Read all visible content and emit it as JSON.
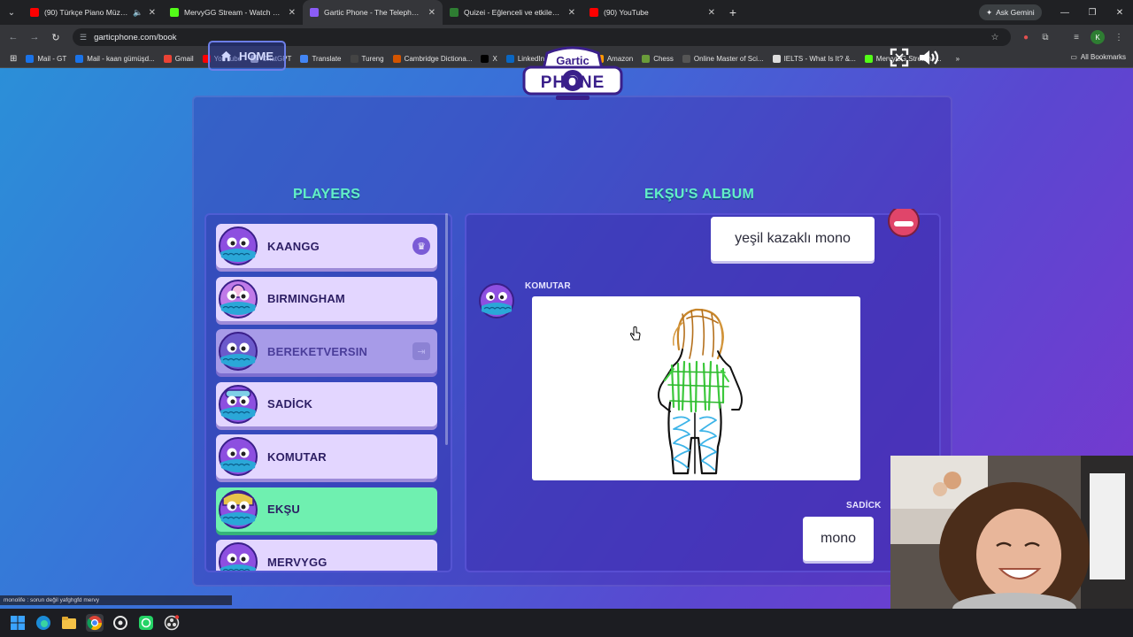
{
  "browser": {
    "tabs": [
      {
        "title": "(90) Türkçe Piano Müzikleri",
        "favicon_color": "#ff0000",
        "audio": true
      },
      {
        "title": "MervyGG Stream - Watch Live",
        "favicon_color": "#53fc18"
      },
      {
        "title": "Gartic Phone - The Telephone G",
        "favicon_color": "#8b5cf6",
        "active": true
      },
      {
        "title": "Quizei - Eğlenceli ve etkileşimli",
        "favicon_color": "#2e7d32"
      },
      {
        "title": "(90) YouTube",
        "favicon_color": "#ff0000"
      }
    ],
    "gemini_label": "Ask Gemini",
    "url": "garticphone.com/book",
    "bookmarks": [
      {
        "label": "Mail - GT",
        "color": "#1a73e8"
      },
      {
        "label": "Mail - kaan gümüşd...",
        "color": "#1a73e8"
      },
      {
        "label": "Gmail",
        "color": "#ea4335"
      },
      {
        "label": "YouTube",
        "color": "#ff0000"
      },
      {
        "label": "ChatGPT",
        "color": "#cccccc"
      },
      {
        "label": "Translate",
        "color": "#4285f4"
      },
      {
        "label": "Tureng",
        "color": "#444444"
      },
      {
        "label": "Cambridge Dictiona...",
        "color": "#d35400"
      },
      {
        "label": "X",
        "color": "#000000"
      },
      {
        "label": "LinkedIn",
        "color": "#0a66c2"
      },
      {
        "label": "Writing",
        "color": "#333333"
      },
      {
        "label": "Amazon",
        "color": "#ff9900"
      },
      {
        "label": "Chess",
        "color": "#6a9c3a"
      },
      {
        "label": "Online Master of Sci...",
        "color": "#555555"
      },
      {
        "label": "IELTS - What Is It? &...",
        "color": "#dddddd"
      },
      {
        "label": "MervyGG Stream -...",
        "color": "#53fc18"
      }
    ],
    "all_bookmarks": "All Bookmarks"
  },
  "game": {
    "home_label": "HOME",
    "logo_top": "Gartic",
    "logo_bottom": "PHONE",
    "players_title": "PLAYERS",
    "album_title": "EKŞU'S ALBUM",
    "players": [
      {
        "name": "KAANGG",
        "badge": "crown",
        "style": "normal"
      },
      {
        "name": "BIRMINGHAM",
        "style": "normal"
      },
      {
        "name": "BEREKETVERSIN",
        "badge": "leave",
        "style": "dim"
      },
      {
        "name": "SADİCK",
        "style": "normal"
      },
      {
        "name": "KOMUTAR",
        "style": "normal"
      },
      {
        "name": "EKŞU",
        "style": "me"
      },
      {
        "name": "MERVYGG",
        "style": "normal"
      }
    ],
    "album": {
      "first_text": "yeşil kazaklı mono",
      "drawing_author": "KOMUTAR",
      "second_author": "SADİCK",
      "second_text": "mono"
    }
  },
  "stream": {
    "chat_ticker": "monolife : sorun değil yafghgfd mervy"
  }
}
